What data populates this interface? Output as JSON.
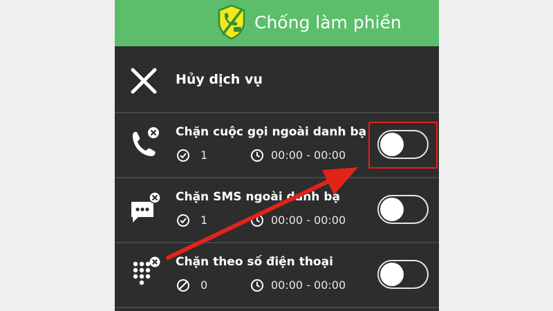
{
  "header": {
    "title": "Chống làm phiền",
    "logo_icon": "shield-phone-icon",
    "background_color": "#5cbe6a"
  },
  "cancel_row": {
    "label": "Hủy dịch vụ",
    "icon": "close-icon"
  },
  "settings": [
    {
      "title": "Chặn cuộc gọi ngoài danh bạ",
      "icon": "blocked-call-icon",
      "count_icon": "check-circle-icon",
      "count": "1",
      "time_icon": "clock-icon",
      "time": "00:00 - 00:00",
      "enabled": false
    },
    {
      "title": "Chặn SMS ngoài danh bạ",
      "icon": "blocked-sms-icon",
      "count_icon": "check-circle-icon",
      "count": "1",
      "time_icon": "clock-icon",
      "time": "00:00 - 00:00",
      "enabled": false
    },
    {
      "title": "Chặn theo số điện thoại",
      "icon": "blocked-dialpad-icon",
      "count_icon": "blocked-circle-icon",
      "count": "0",
      "time_icon": "clock-icon",
      "time": "00:00 - 00:00",
      "enabled": false
    }
  ],
  "annotation": {
    "highlight_color": "#e2231a",
    "arrow_color": "#e2231a"
  }
}
